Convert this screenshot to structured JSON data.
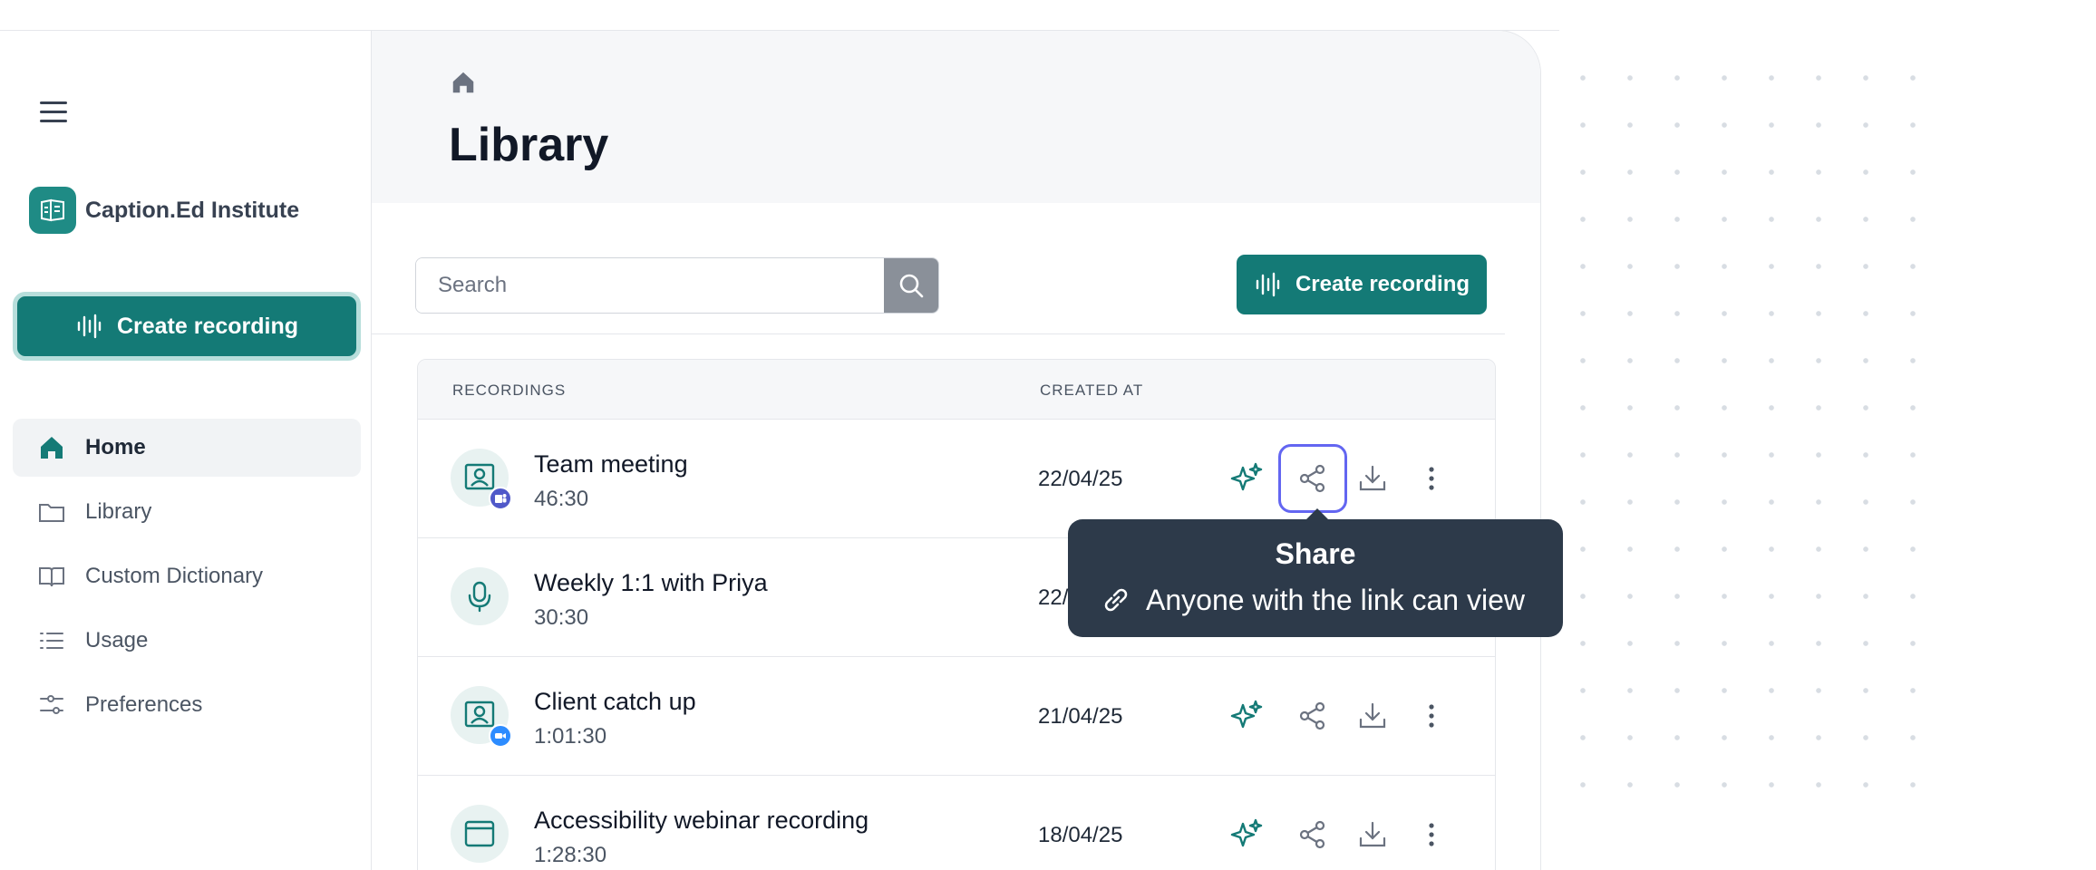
{
  "brand": {
    "name": "Caption.Ed Institute"
  },
  "sidebar": {
    "create_label": "Create recording",
    "items": [
      {
        "label": "Home",
        "icon": "home-icon",
        "active": true
      },
      {
        "label": "Library",
        "icon": "folder-icon"
      },
      {
        "label": "Custom Dictionary",
        "icon": "book-icon"
      },
      {
        "label": "Usage",
        "icon": "list-icon"
      },
      {
        "label": "Preferences",
        "icon": "sliders-icon"
      }
    ]
  },
  "main": {
    "title": "Library",
    "search": {
      "placeholder": "Search",
      "value": ""
    },
    "create_label": "Create recording",
    "table": {
      "headers": {
        "recordings": "RECORDINGS",
        "created_at": "CREATED AT"
      },
      "rows": [
        {
          "title": "Team meeting",
          "duration": "46:30",
          "date": "22/04/25",
          "icon": "contact-card-icon",
          "badge": "teams-badge-icon"
        },
        {
          "title": "Weekly 1:1 with Priya",
          "duration": "30:30",
          "date": "22/04/25",
          "icon": "microphone-icon"
        },
        {
          "title": "Client catch up",
          "duration": "1:01:30",
          "date": "21/04/25",
          "icon": "contact-card-icon",
          "badge": "zoom-badge-icon"
        },
        {
          "title": "Accessibility webinar recording",
          "duration": "1:28:30",
          "date": "18/04/25",
          "icon": "browser-window-icon"
        }
      ]
    }
  },
  "tooltip": {
    "title": "Share",
    "body": "Anyone with the link can view"
  },
  "colors": {
    "brand": "#147a76",
    "brand_light": "#b7dedb",
    "focus": "#6366f1",
    "tooltip_bg": "#2d3a4a"
  }
}
